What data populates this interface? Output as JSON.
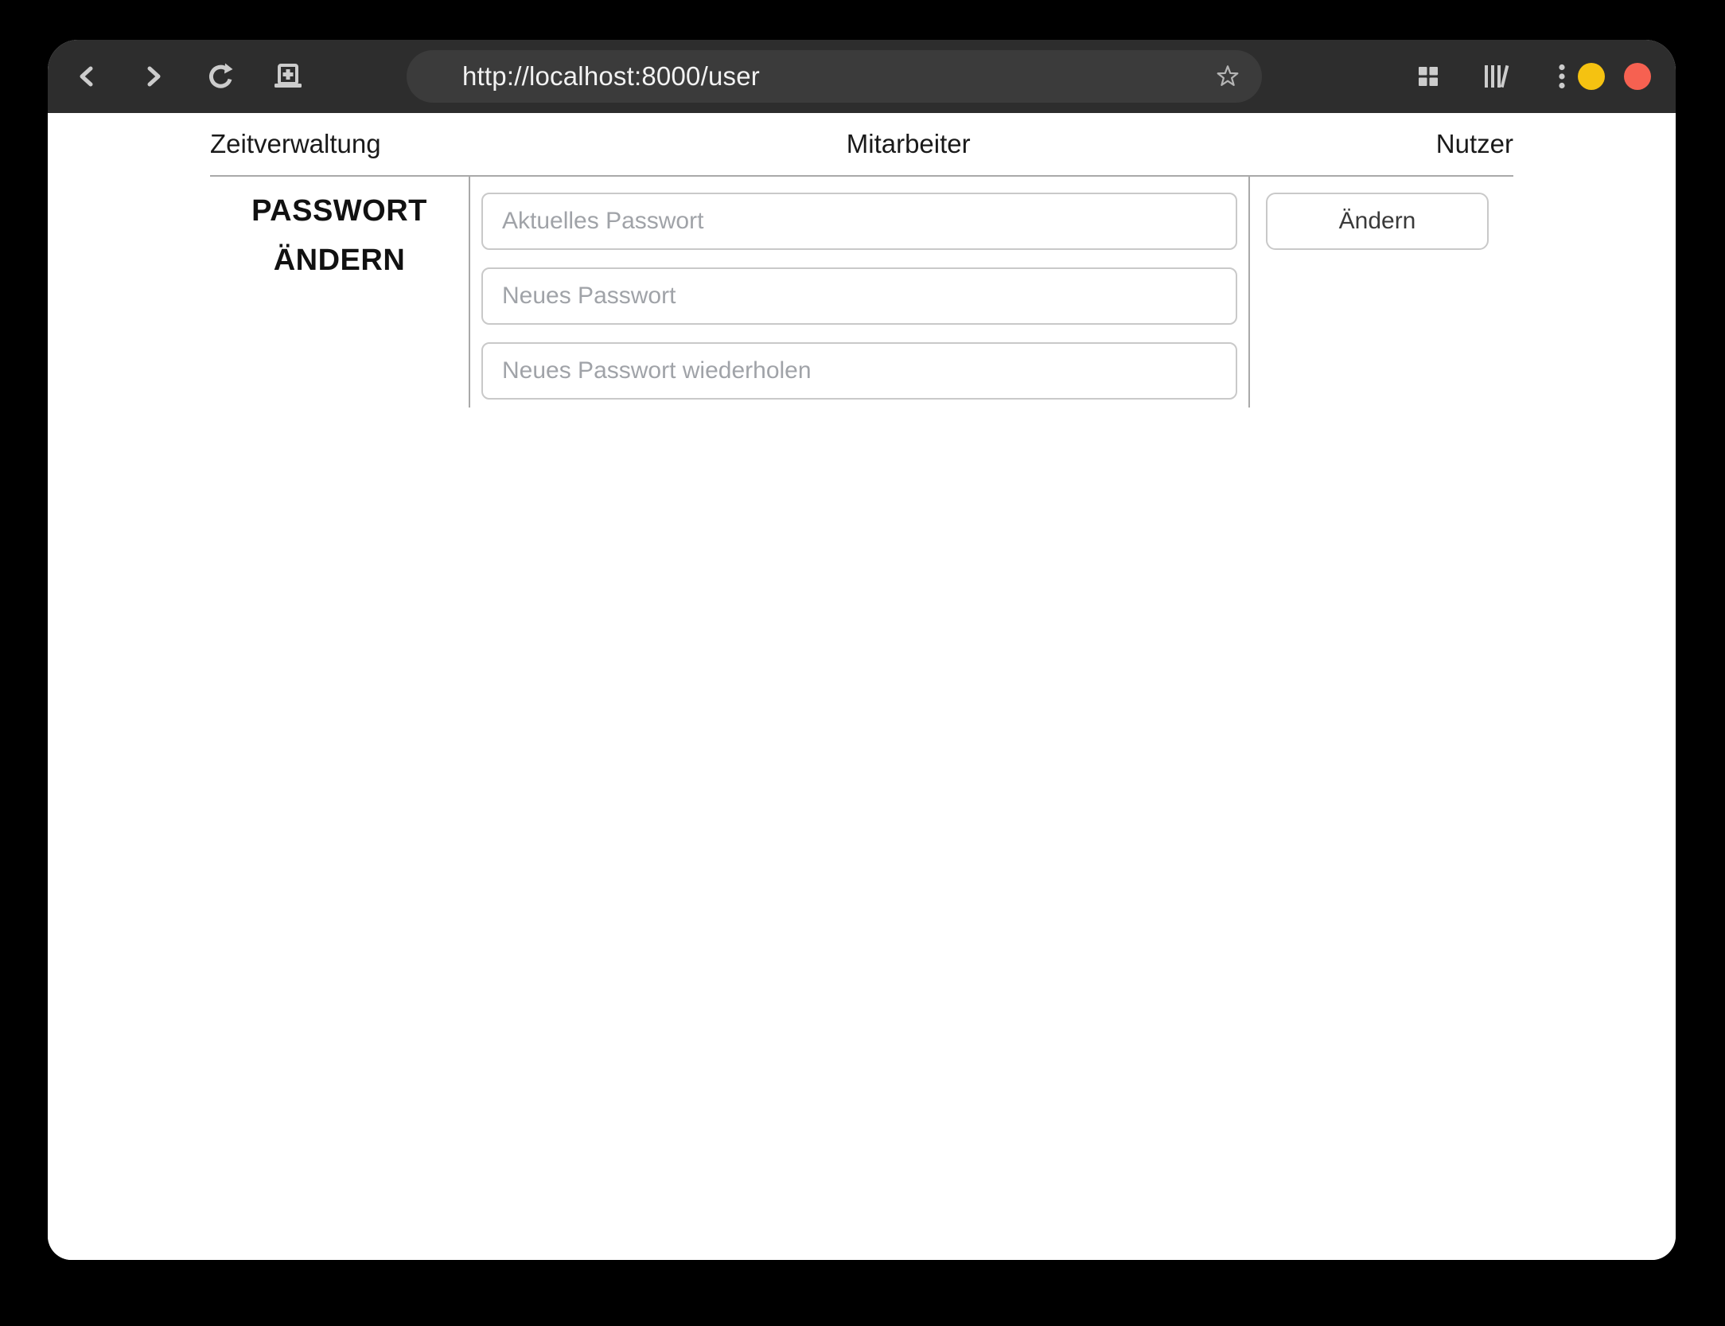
{
  "browser": {
    "url": "http://localhost:8000/user",
    "icons": {
      "back": "back-icon",
      "forward": "forward-icon",
      "reload": "reload-icon",
      "new_tab_page": "new-tab-icon",
      "bookmark": "star-icon",
      "tab_overview": "grid-icon",
      "library": "library-icon",
      "menu": "kebab-menu-icon"
    },
    "window_controls": {
      "minimize_color": "#f5c211",
      "close_color": "#f66151"
    },
    "colors": {
      "toolbar_bg": "#2d2d2d",
      "urlbar_bg": "#3b3b3b",
      "icon_gray": "#cccccc"
    }
  },
  "nav": {
    "items": [
      "Zeitverwaltung",
      "Mitarbeiter",
      "Nutzer"
    ]
  },
  "password_form": {
    "heading": "PASSWORT ÄNDERN",
    "fields": [
      {
        "placeholder": "Aktuelles Passwort",
        "value": ""
      },
      {
        "placeholder": "Neues Passwort",
        "value": ""
      },
      {
        "placeholder": "Neues Passwort wiederholen",
        "value": ""
      }
    ],
    "submit_label": "Ändern"
  },
  "page_colors": {
    "divider": "#a9a9a9",
    "input_border": "#c9c9c9",
    "placeholder": "#a0a3a8"
  }
}
